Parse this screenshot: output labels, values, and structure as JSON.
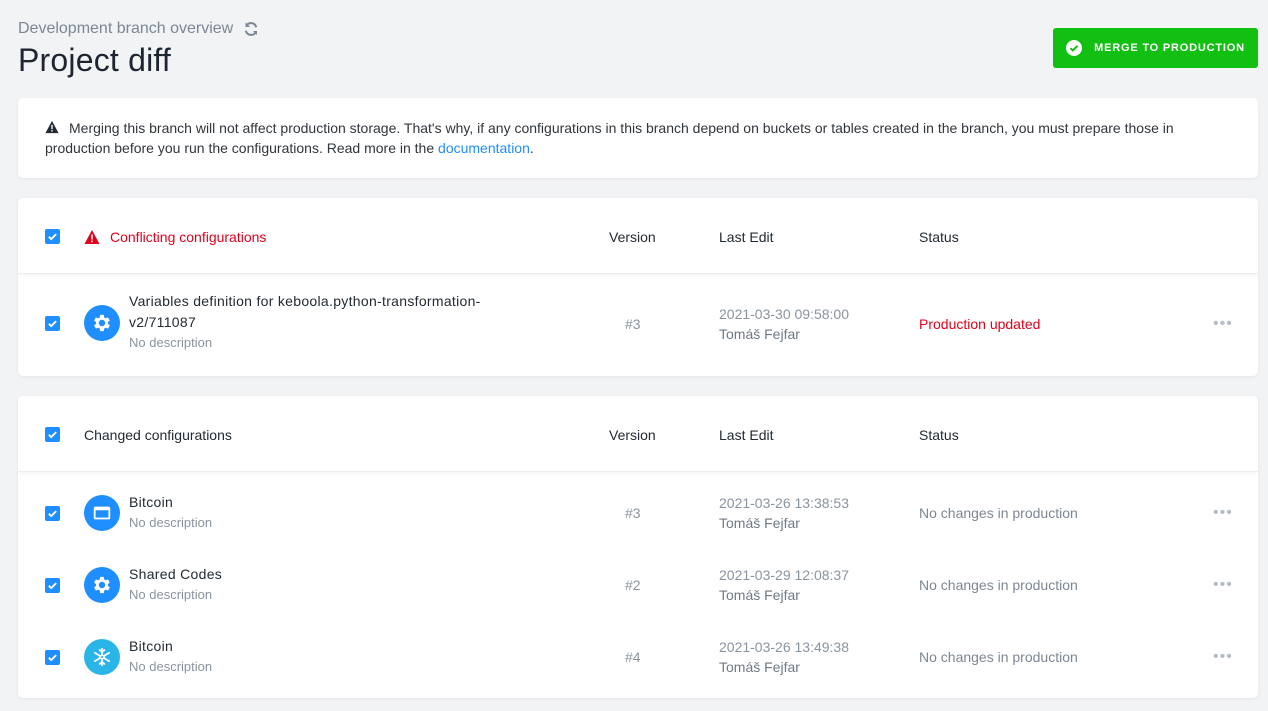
{
  "header": {
    "breadcrumb": "Development branch overview",
    "title": "Project diff",
    "merge_label": "MERGE TO PRODUCTION"
  },
  "notice": {
    "text": "Merging this branch will not affect production storage. That's why, if any configurations in this branch depend on buckets or tables created in the branch, you must prepare those in production before you run the configurations. Read more in the ",
    "link_text": "documentation",
    "suffix": "."
  },
  "columns": {
    "version": "Version",
    "last_edit": "Last Edit",
    "status": "Status"
  },
  "conflicting": {
    "title": "Conflicting configurations",
    "rows": [
      {
        "name_line1": "Variables definition for keboola.python-transformation-",
        "name_line2": "v2/711087",
        "description": "No description",
        "version": "#3",
        "date": "2021-03-30 09:58:00",
        "user": "Tomáš Fejfar",
        "status": "Production updated"
      }
    ]
  },
  "changed": {
    "title": "Changed configurations",
    "rows": [
      {
        "name": "Bitcoin",
        "description": "No description",
        "version": "#3",
        "date": "2021-03-26 13:38:53",
        "user": "Tomáš Fejfar",
        "status": "No changes in production",
        "icon": "window-icon"
      },
      {
        "name": "Shared Codes",
        "description": "No description",
        "version": "#2",
        "date": "2021-03-29 12:08:37",
        "user": "Tomáš Fejfar",
        "status": "No changes in production",
        "icon": "gear-icon"
      },
      {
        "name": "Bitcoin",
        "description": "No description",
        "version": "#4",
        "date": "2021-03-26 13:49:38",
        "user": "Tomáš Fejfar",
        "status": "No changes in production",
        "icon": "snowflake-icon"
      }
    ]
  },
  "more_label": "•••",
  "colors": {
    "accent": "#1f8fff",
    "merge_green": "#11c011",
    "conflict_red": "#e3001b",
    "snowflake": "#29b5e8"
  }
}
